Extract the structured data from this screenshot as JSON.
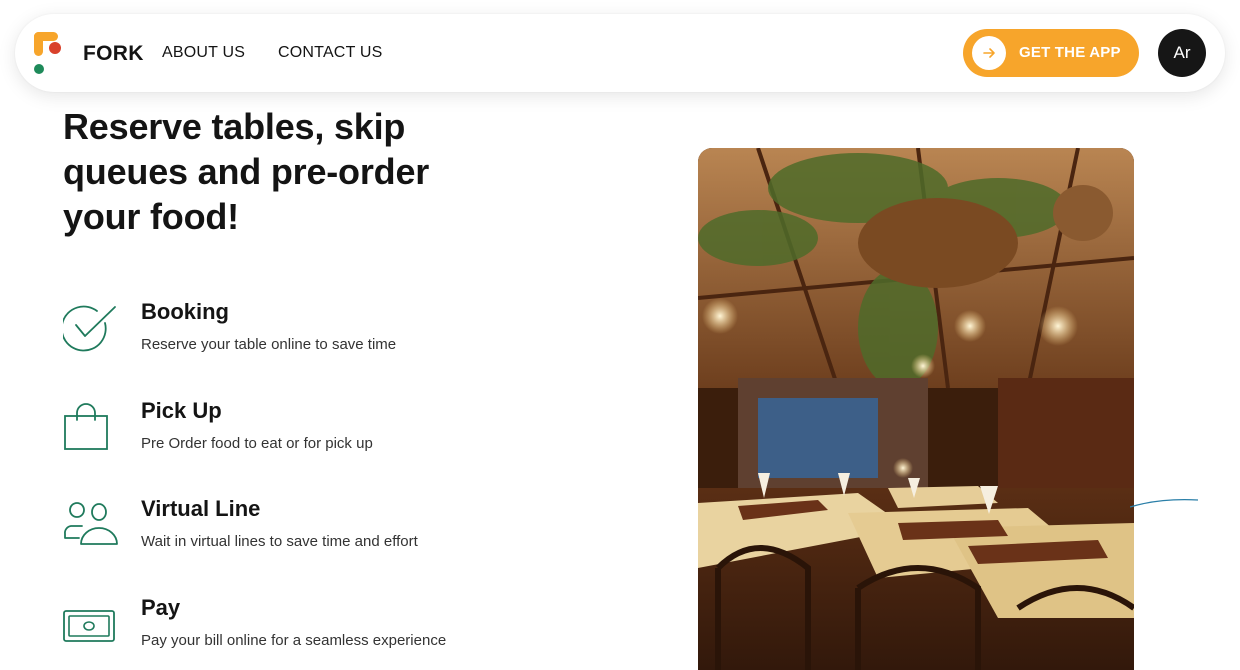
{
  "header": {
    "logo_text": "FORK",
    "nav": [
      {
        "label": "ABOUT US"
      },
      {
        "label": "CONTACT US"
      }
    ],
    "cta_label": "GET THE APP",
    "avatar_initials": "Ar"
  },
  "hero": {
    "headline": "Reserve tables, skip queues and pre-order your food!"
  },
  "features": [
    {
      "icon": "check-circle-icon",
      "title": "Booking",
      "description": "Reserve your table online to save time"
    },
    {
      "icon": "shopping-bag-icon",
      "title": "Pick Up",
      "description": "Pre Order food to eat or for pick up"
    },
    {
      "icon": "users-icon",
      "title": "Virtual Line",
      "description": "Wait in virtual lines to save time and effort"
    },
    {
      "icon": "banknote-icon",
      "title": "Pay",
      "description": "Pay your bill online for a seamless experience"
    }
  ],
  "colors": {
    "accent": "#f7a52b",
    "brand_red": "#d9412b",
    "brand_green": "#1e8a5a",
    "icon_green": "#1f7a5c",
    "dark": "#141414"
  }
}
